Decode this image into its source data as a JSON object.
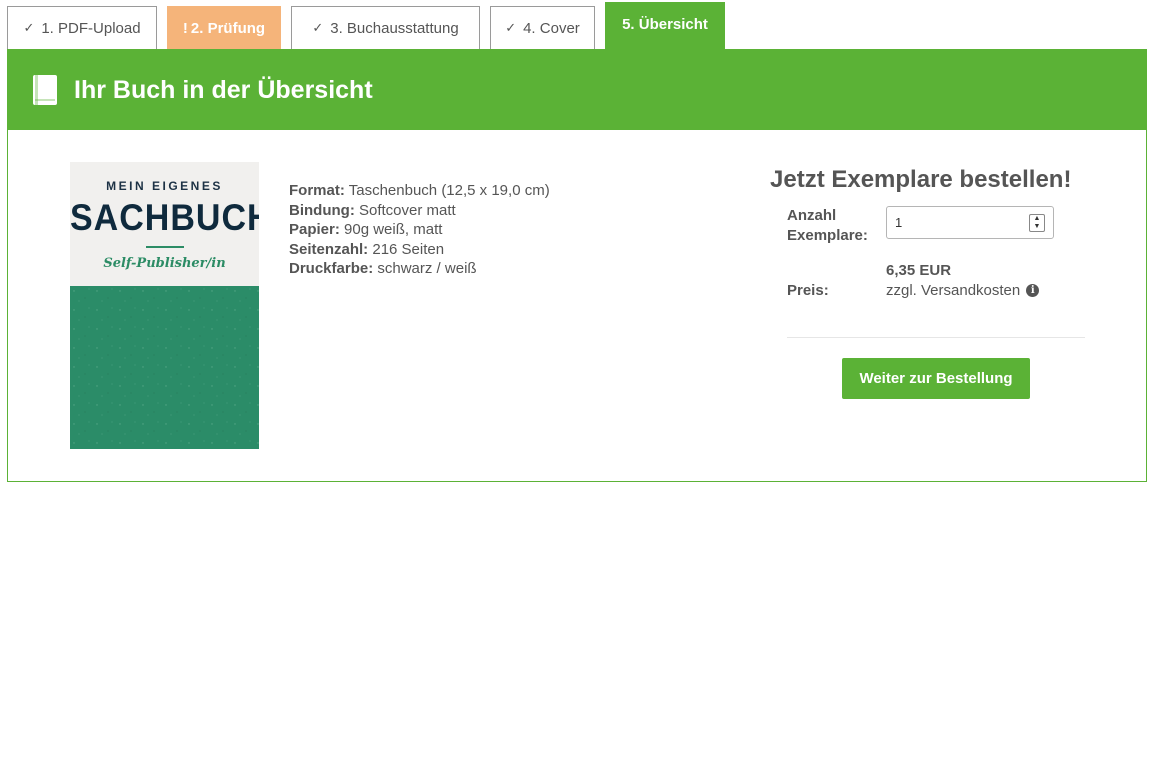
{
  "tabs": [
    {
      "label": "1. PDF-Upload",
      "status": "done"
    },
    {
      "label": "2. Prüfung",
      "status": "warning",
      "marker": "!"
    },
    {
      "label": "3. Buchausstattung",
      "status": "done"
    },
    {
      "label": "4. Cover",
      "status": "done"
    },
    {
      "label": "5. Übersicht",
      "status": "active"
    }
  ],
  "panel": {
    "title": "Ihr Buch in der Übersicht",
    "icon": "book-icon"
  },
  "cover": {
    "line1": "MEIN EIGENES",
    "line2": "SACHBUCH",
    "line3": "Self-Publisher/in"
  },
  "specs": [
    {
      "label": "Format:",
      "value": "Taschenbuch (12,5 x 19,0 cm)"
    },
    {
      "label": "Bindung:",
      "value": "Softcover matt"
    },
    {
      "label": "Papier:",
      "value": "90g weiß, matt"
    },
    {
      "label": "Seitenzahl:",
      "value": "216 Seiten"
    },
    {
      "label": "Druckfarbe:",
      "value": "schwarz / weiß"
    }
  ],
  "order": {
    "title": "Jetzt Exemplare bestellen!",
    "qty_label_1": "Anzahl",
    "qty_label_2": "Exemplare:",
    "qty_value": "1",
    "price_label": "Preis:",
    "price_value": "6,35 EUR",
    "price_note": "zzgl. Versandkosten",
    "button_label": "Weiter zur Bestellung"
  },
  "colors": {
    "accent": "#5bb236",
    "warning": "#f5b47a",
    "cover_green": "#2b8c68",
    "text": "#555555"
  }
}
